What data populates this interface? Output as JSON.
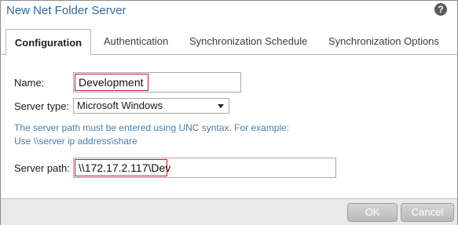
{
  "dialog": {
    "title": "New Net Folder Server",
    "help_icon": "?"
  },
  "tabs": [
    {
      "label": "Configuration",
      "active": true
    },
    {
      "label": "Authentication",
      "active": false
    },
    {
      "label": "Synchronization Schedule",
      "active": false
    },
    {
      "label": "Synchronization Options",
      "active": false
    }
  ],
  "form": {
    "name_label": "Name:",
    "name_value": "Development",
    "server_type_label": "Server type:",
    "server_type_value": "Microsoft Windows",
    "hint_line1": "The server path must be entered using UNC syntax. For example:",
    "hint_line2": "Use \\\\server ip address\\share",
    "server_path_label": "Server path:",
    "server_path_value": "\\\\172.17.2.117\\Dev"
  },
  "buttons": {
    "ok": "OK",
    "cancel": "Cancel"
  },
  "colors": {
    "title": "#2f6a9c",
    "hint": "#4a7ea8",
    "highlight_border": "#c8102e"
  }
}
